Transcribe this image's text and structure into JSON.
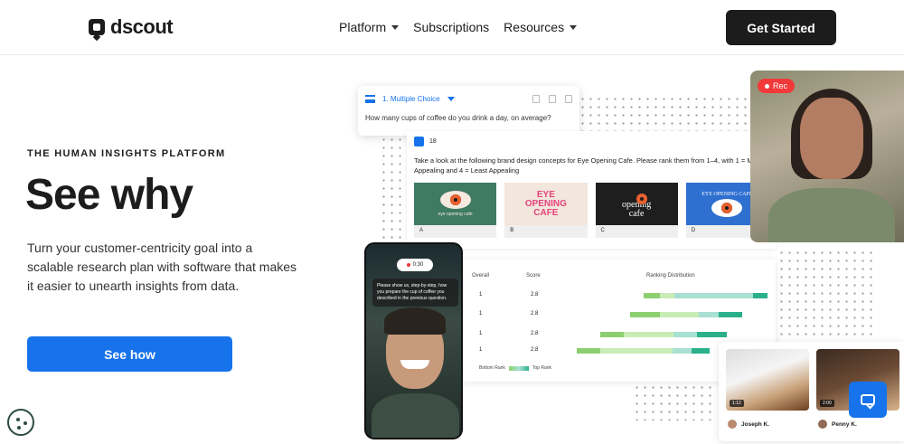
{
  "header": {
    "logo_text": "dscout",
    "nav": [
      {
        "label": "Platform",
        "dropdown": true
      },
      {
        "label": "Subscriptions",
        "dropdown": false
      },
      {
        "label": "Resources",
        "dropdown": true
      }
    ],
    "cta_label": "Get Started"
  },
  "hero": {
    "eyebrow": "THE HUMAN INSIGHTS PLATFORM",
    "title": "See why",
    "body": "Turn your customer-centricity goal into a scalable research plan with software that makes it easier to unearth insights from data.",
    "button_label": "See how"
  },
  "question_card": {
    "type_label": "1. Multiple Choice",
    "question": "How many cups of coffee do you drink a day, on average?"
  },
  "brand_card": {
    "count": "18",
    "prompt": "Take a look at the following brand design concepts for Eye Opening Cafe. Please rank them from 1–4, with 1 = Most Appealing and 4 = Least Appealing",
    "tiles": [
      {
        "label": "A",
        "text": "eye opening cafe",
        "bg": "#3f7a63",
        "fg": "#f6e9df"
      },
      {
        "label": "B",
        "text": "EYE OPENING CAFE",
        "bg": "#f3e6dc",
        "fg": "#e5437d"
      },
      {
        "label": "C",
        "text": "opening cafe",
        "bg": "#1e1e1e",
        "fg": "#ffffff"
      },
      {
        "label": "D",
        "text": "EYE OPENING CAFE",
        "bg": "#2e6fd0",
        "fg": "#ffffff"
      }
    ]
  },
  "ranking": {
    "headers": {
      "overall": "Overall",
      "score": "Score",
      "distribution": "Ranking Distribution"
    },
    "rows": [
      {
        "overall": "1",
        "score": "2.8"
      },
      {
        "overall": "1",
        "score": "2.8"
      },
      {
        "overall": "1",
        "score": "2.8"
      },
      {
        "overall": "1",
        "score": "2.8"
      }
    ],
    "legend": {
      "low": "Bottom Rank",
      "high": "Top Rank"
    }
  },
  "video": {
    "rec_label": "Rec",
    "phone_timer": "0:30",
    "phone_caption": "Please show us, step-by-step, how you prepare the cup of coffee you described in the previous question."
  },
  "clips": [
    {
      "name": "Joseph K.",
      "duration": "1:12"
    },
    {
      "name": "Penny K.",
      "duration": "2:00"
    }
  ],
  "colors": {
    "accent": "#1673eb",
    "dark": "#1c1c1c",
    "rec": "#f2393a"
  }
}
